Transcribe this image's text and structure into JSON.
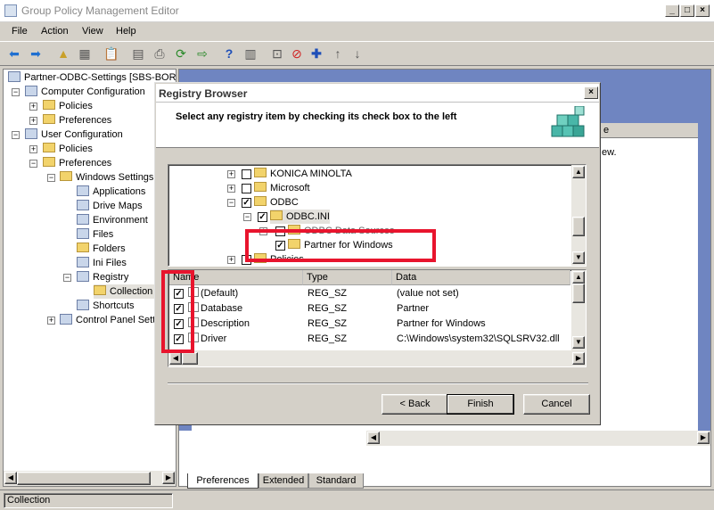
{
  "window": {
    "title": "Group Policy Management Editor",
    "minimize": "_",
    "maximize": "□",
    "close": "×"
  },
  "menubar": [
    "File",
    "Action",
    "View",
    "Help"
  ],
  "tree": {
    "root": "Partner-ODBC-Settings [SBS-BORC",
    "computer_config": "Computer Configuration",
    "policies_1": "Policies",
    "preferences_1": "Preferences",
    "user_config": "User Configuration",
    "policies_2": "Policies",
    "preferences_2": "Preferences",
    "windows_settings": "Windows Settings",
    "applications": "Applications",
    "drive_maps": "Drive Maps",
    "environment": "Environment",
    "files": "Files",
    "folders": "Folders",
    "ini_files": "Ini Files",
    "registry": "Registry",
    "collection": "Collection",
    "shortcuts": "Shortcuts",
    "control_panel": "Control Panel Sett"
  },
  "right_pane": {
    "partial_text": "ew.",
    "partial_col": "e"
  },
  "bottom_tabs": [
    "Preferences",
    "Extended",
    "Standard"
  ],
  "status": "Collection",
  "dialog": {
    "title": "Registry Browser",
    "close": "×",
    "instruction": "Select any registry item by checking its check box to the left",
    "tree_items": [
      {
        "label": "KONICA MINOLTA",
        "checked": false
      },
      {
        "label": "Microsoft",
        "checked": false
      },
      {
        "label": "ODBC",
        "checked": true
      },
      {
        "label": "ODBC.INI",
        "checked": true
      },
      {
        "label": "ODBC Data Sources",
        "checked": false
      },
      {
        "label": "Partner for Windows",
        "checked": true
      },
      {
        "label": "Policies",
        "checked": false
      }
    ],
    "columns": [
      "Name",
      "Type",
      "Data"
    ],
    "rows": [
      {
        "name": "(Default)",
        "type": "REG_SZ",
        "data": "(value not set)",
        "checked": true
      },
      {
        "name": "Database",
        "type": "REG_SZ",
        "data": "Partner",
        "checked": true
      },
      {
        "name": "Description",
        "type": "REG_SZ",
        "data": "Partner for Windows",
        "checked": true
      },
      {
        "name": "Driver",
        "type": "REG_SZ",
        "data": "C:\\Windows\\system32\\SQLSRV32.dll",
        "checked": true
      }
    ],
    "buttons": {
      "back": "< Back",
      "finish": "Finish",
      "cancel": "Cancel"
    }
  },
  "highlight_color": "#e8142d"
}
